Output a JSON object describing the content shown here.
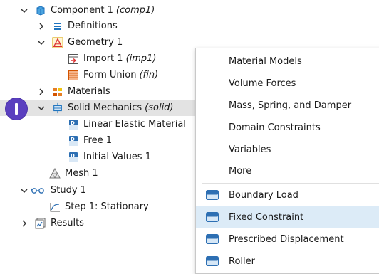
{
  "tree": {
    "component": {
      "label": "Component 1",
      "tag": "(comp1)"
    },
    "definitions": {
      "label": "Definitions"
    },
    "geometry": {
      "label": "Geometry 1"
    },
    "import": {
      "label": "Import 1",
      "tag": "(imp1)"
    },
    "form_union": {
      "label": "Form Union",
      "tag": "(fin)"
    },
    "materials": {
      "label": "Materials"
    },
    "solid": {
      "label": "Solid Mechanics",
      "tag": "(solid)"
    },
    "linear_elastic": {
      "label": "Linear Elastic Material"
    },
    "free": {
      "label": "Free 1"
    },
    "initial_values": {
      "label": "Initial Values 1"
    },
    "mesh": {
      "label": "Mesh 1"
    },
    "study": {
      "label": "Study 1"
    },
    "step": {
      "label": "Step 1: Stationary"
    },
    "results": {
      "label": "Results"
    }
  },
  "menu": {
    "items": [
      {
        "label": "Material Models"
      },
      {
        "label": "Volume Forces"
      },
      {
        "label": "Mass, Spring, and Damper"
      },
      {
        "label": "Domain Constraints"
      },
      {
        "label": "Variables"
      },
      {
        "label": "More"
      },
      {
        "label": "Boundary Load"
      },
      {
        "label": "Fixed Constraint"
      },
      {
        "label": "Prescribed Displacement"
      },
      {
        "label": "Roller"
      }
    ]
  },
  "colors": {
    "accent": "#5a3fbf",
    "highlight": "#dcebf7",
    "selected": "#e3e3e3",
    "icon_blue": "#1e73be"
  }
}
